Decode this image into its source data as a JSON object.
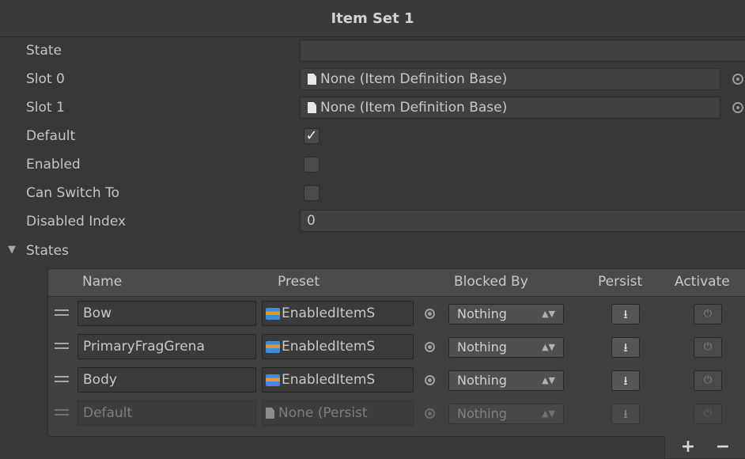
{
  "header": {
    "title": "Item Set 1"
  },
  "properties": {
    "state": {
      "label": "State",
      "value": ""
    },
    "slot0": {
      "label": "Slot 0",
      "value": "None (Item Definition Base)"
    },
    "slot1": {
      "label": "Slot 1",
      "value": "None (Item Definition Base)"
    },
    "default": {
      "label": "Default",
      "checked": true,
      "mark": "✓"
    },
    "enabled": {
      "label": "Enabled",
      "checked": false
    },
    "can_switch_to": {
      "label": "Can Switch To",
      "checked": false
    },
    "disabled_index": {
      "label": "Disabled Index",
      "value": "0"
    }
  },
  "states": {
    "label": "States",
    "expanded": true,
    "columns": {
      "name": "Name",
      "preset": "Preset",
      "blocked_by": "Blocked By",
      "persist": "Persist",
      "activate": "Activate"
    },
    "rows": [
      {
        "name": "Bow",
        "preset": "EnabledItemS",
        "blocked_by": "Nothing",
        "enabled": true
      },
      {
        "name": "PrimaryFragGrena",
        "preset": "EnabledItemS",
        "blocked_by": "Nothing",
        "enabled": true
      },
      {
        "name": "Body",
        "preset": "EnabledItemS",
        "blocked_by": "Nothing",
        "enabled": true
      },
      {
        "name": "Default",
        "preset": "None (Persist",
        "blocked_by": "Nothing",
        "enabled": false
      }
    ]
  },
  "footer": {
    "add_label": "+",
    "remove_label": "−"
  },
  "icons": {
    "persist": "download-icon",
    "activate": "power-icon",
    "dropdown": "updown-arrow-icon"
  }
}
